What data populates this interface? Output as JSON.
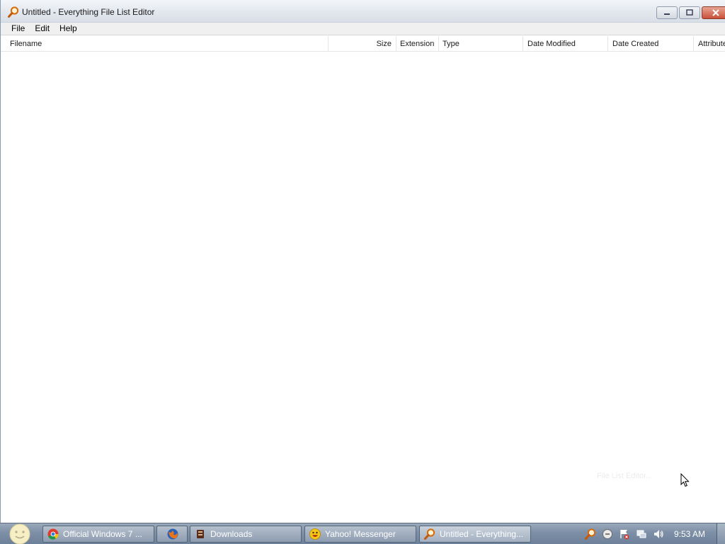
{
  "window": {
    "title": "Untitled - Everything File List Editor"
  },
  "menu": [
    "File",
    "Edit",
    "Help"
  ],
  "columns": [
    "Filename",
    "Size",
    "Extension",
    "Type",
    "Date Modified",
    "Date Created",
    "Attribute"
  ],
  "status_ghost": "File List Editor...",
  "taskbar": {
    "tasks": [
      {
        "label": "Official Windows 7 ...",
        "icon": "chrome-icon"
      },
      {
        "label": "",
        "icon": "firefox-icon"
      },
      {
        "label": "Downloads",
        "icon": "downloads-icon"
      },
      {
        "label": "Yahoo! Messenger",
        "icon": "yahoo-messenger-icon"
      },
      {
        "label": "Untitled - Everything...",
        "icon": "everything-icon"
      }
    ],
    "clock": "9:53 AM"
  },
  "colors": {
    "accent": "#e07b14",
    "taskbar": "#7d8fa6"
  }
}
